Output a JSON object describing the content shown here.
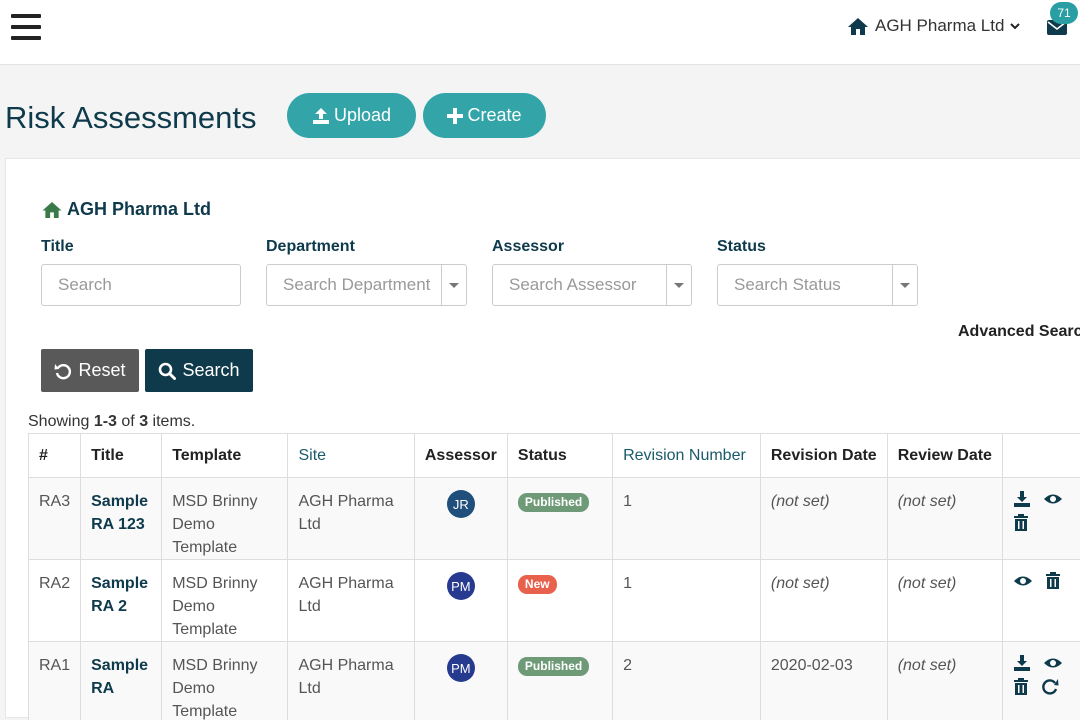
{
  "header": {
    "org_name": "AGH Pharma Ltd",
    "mail_count": "71"
  },
  "page": {
    "title": "Risk Assessments",
    "upload_label": "Upload",
    "create_label": "Create"
  },
  "filters": {
    "org_name": "AGH Pharma Ltd",
    "title_label": "Title",
    "title_placeholder": "Search",
    "department_label": "Department",
    "department_placeholder": "Search Department",
    "assessor_label": "Assessor",
    "assessor_placeholder": "Search Assessor",
    "status_label": "Status",
    "status_placeholder": "Search Status",
    "advanced_search": "Advanced Search",
    "reset_label": "Reset",
    "search_label": "Search"
  },
  "summary": {
    "prefix": "Showing ",
    "range": "1-3",
    "middle": " of ",
    "total": "3",
    "suffix": " items."
  },
  "table": {
    "headers": [
      "#",
      "Title",
      "Template",
      "Site",
      "Assessor",
      "Status",
      "Revision Number",
      "Revision Date",
      "Review Date"
    ],
    "rows": [
      {
        "id": "RA3",
        "title": "Sample RA 123",
        "template": "MSD Brinny Demo Template",
        "site": "AGH Pharma Ltd",
        "assessor": "JR",
        "assessor_color": "#1f4f7a",
        "status": "Published",
        "status_color": "#6f9a78",
        "revision_number": "1",
        "revision_date": "(not set)",
        "review_date": "(not set)"
      },
      {
        "id": "RA2",
        "title": "Sample RA 2",
        "template": "MSD Brinny Demo Template",
        "site": "AGH Pharma Ltd",
        "assessor": "PM",
        "assessor_color": "#263a8f",
        "status": "New",
        "status_color": "#e8614d",
        "revision_number": "1",
        "revision_date": "(not set)",
        "review_date": "(not set)"
      },
      {
        "id": "RA1",
        "title": "Sample RA",
        "template": "MSD Brinny Demo Template",
        "site": "AGH Pharma Ltd",
        "assessor": "PM",
        "assessor_color": "#263a8f",
        "status": "Published",
        "status_color": "#6f9a78",
        "revision_number": "2",
        "revision_date": "2020-02-03",
        "review_date": "(not set)"
      }
    ]
  },
  "icons": {
    "home": "home-icon",
    "mail": "envelope-icon",
    "upload": "upload-icon",
    "create": "plus-icon",
    "reset": "undo-icon",
    "search": "magnifier-icon",
    "download": "download-icon",
    "view": "eye-icon",
    "delete": "trash-icon",
    "revise": "refresh-icon"
  },
  "colors": {
    "primary": "#0e3a4c",
    "accent": "#33a5a8",
    "danger_text": "#c9534f"
  }
}
